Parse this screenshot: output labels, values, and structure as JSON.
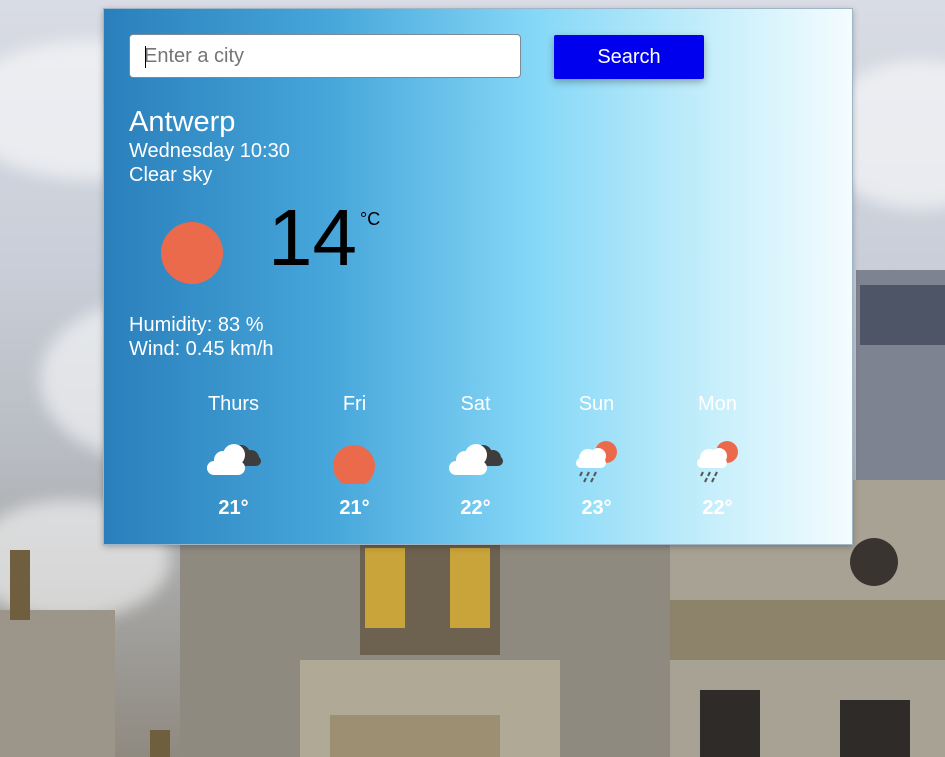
{
  "search": {
    "placeholder": "Enter a city",
    "button_label": "Search"
  },
  "current": {
    "city": "Antwerp",
    "datetime": "Wednesday 10:30",
    "description": "Clear sky",
    "temperature": "14",
    "unit": "°C",
    "icon": "sun-icon",
    "humidity": "Humidity: 83 %",
    "wind": "Wind: 0.45 km/h"
  },
  "forecast": [
    {
      "day": "Thurs",
      "icon": "cloudy-icon",
      "temp": "21°"
    },
    {
      "day": "Fri",
      "icon": "sun-icon",
      "temp": "21°"
    },
    {
      "day": "Sat",
      "icon": "cloudy-icon",
      "temp": "22°"
    },
    {
      "day": "Sun",
      "icon": "rain-sun-icon",
      "temp": "23°"
    },
    {
      "day": "Mon",
      "icon": "rain-sun-icon",
      "temp": "22°"
    }
  ],
  "colors": {
    "accent_button": "#0000ee",
    "sun": "#ec6a4c"
  }
}
